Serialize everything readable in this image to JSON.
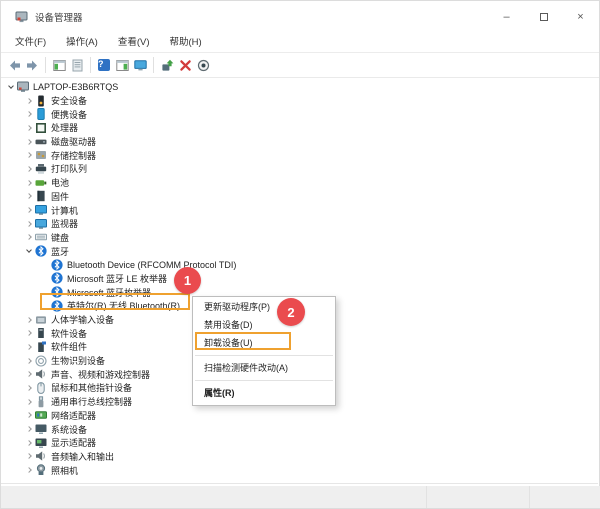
{
  "window": {
    "title": "设备管理器",
    "controls": [
      {
        "name": "minimize",
        "glyph": "–"
      },
      {
        "name": "maximize",
        "glyph": ""
      },
      {
        "name": "close",
        "glyph": "×"
      }
    ]
  },
  "menubar": {
    "items": [
      {
        "key": "file",
        "label": "文件(F)"
      },
      {
        "key": "action",
        "label": "操作(A)"
      },
      {
        "key": "view",
        "label": "查看(V)"
      },
      {
        "key": "help",
        "label": "帮助(H)"
      }
    ]
  },
  "toolbar": {
    "items": [
      {
        "icon": "back-icon"
      },
      {
        "icon": "forward-icon"
      },
      {
        "sep": true
      },
      {
        "icon": "console-tree-icon"
      },
      {
        "icon": "properties-icon"
      },
      {
        "sep": true
      },
      {
        "icon": "help-icon",
        "glyph": "?"
      },
      {
        "icon": "action-pane-icon"
      },
      {
        "icon": "computer-icon"
      },
      {
        "sep": true
      },
      {
        "icon": "update-driver-icon"
      },
      {
        "icon": "uninstall-device-icon"
      },
      {
        "icon": "scan-hardware-icon"
      }
    ]
  },
  "tree": {
    "items": [
      {
        "label": "LAPTOP-E3B6RTQS",
        "level": 0,
        "expander": "expanded",
        "icon": "computer-root-icon"
      },
      {
        "label": "安全设备",
        "level": 1,
        "expander": "collapsed",
        "icon": "security-icon"
      },
      {
        "label": "便携设备",
        "level": 1,
        "expander": "collapsed",
        "icon": "portable-icon"
      },
      {
        "label": "处理器",
        "level": 1,
        "expander": "collapsed",
        "icon": "processor-icon"
      },
      {
        "label": "磁盘驱动器",
        "level": 1,
        "expander": "collapsed",
        "icon": "disk-icon"
      },
      {
        "label": "存储控制器",
        "level": 1,
        "expander": "collapsed",
        "icon": "storage-icon"
      },
      {
        "label": "打印队列",
        "level": 1,
        "expander": "collapsed",
        "icon": "printer-icon"
      },
      {
        "label": "电池",
        "level": 1,
        "expander": "collapsed",
        "icon": "battery-icon"
      },
      {
        "label": "固件",
        "level": 1,
        "expander": "collapsed",
        "icon": "firmware-icon"
      },
      {
        "label": "计算机",
        "level": 1,
        "expander": "collapsed",
        "icon": "computer-icon"
      },
      {
        "label": "监视器",
        "level": 1,
        "expander": "collapsed",
        "icon": "monitor-icon"
      },
      {
        "label": "键盘",
        "level": 1,
        "expander": "collapsed",
        "icon": "keyboard-icon"
      },
      {
        "label": "蓝牙",
        "level": 1,
        "expander": "expanded",
        "icon": "bluetooth-icon"
      },
      {
        "label": "Bluetooth Device (RFCOMM Protocol TDI)",
        "level": 2,
        "expander": null,
        "icon": "bluetooth-icon"
      },
      {
        "label": "Microsoft 蓝牙 LE 枚举器",
        "level": 2,
        "expander": null,
        "icon": "bluetooth-icon"
      },
      {
        "label": "Microsoft 蓝牙枚举器",
        "level": 2,
        "expander": null,
        "icon": "bluetooth-icon"
      },
      {
        "label": "英特尔(R) 无线 Bluetooth(R)",
        "level": 2,
        "expander": null,
        "icon": "bluetooth-icon"
      },
      {
        "label": "人体学输入设备",
        "level": 1,
        "expander": "collapsed",
        "icon": "hid-icon"
      },
      {
        "label": "软件设备",
        "level": 1,
        "expander": "collapsed",
        "icon": "software-device-icon"
      },
      {
        "label": "软件组件",
        "level": 1,
        "expander": "collapsed",
        "icon": "software-component-icon"
      },
      {
        "label": "生物识别设备",
        "level": 1,
        "expander": "collapsed",
        "icon": "biometric-icon"
      },
      {
        "label": "声音、视频和游戏控制器",
        "level": 1,
        "expander": "collapsed",
        "icon": "audio-controller-icon"
      },
      {
        "label": "鼠标和其他指针设备",
        "level": 1,
        "expander": "collapsed",
        "icon": "mouse-icon"
      },
      {
        "label": "通用串行总线控制器",
        "level": 1,
        "expander": "collapsed",
        "icon": "usb-icon"
      },
      {
        "label": "网络适配器",
        "level": 1,
        "expander": "collapsed",
        "icon": "network-icon"
      },
      {
        "label": "系统设备",
        "level": 1,
        "expander": "collapsed",
        "icon": "system-device-icon"
      },
      {
        "label": "显示适配器",
        "level": 1,
        "expander": "collapsed",
        "icon": "display-adapter-icon"
      },
      {
        "label": "音频输入和输出",
        "level": 1,
        "expander": "collapsed",
        "icon": "audio-io-icon"
      },
      {
        "label": "照相机",
        "level": 1,
        "expander": "collapsed",
        "icon": "camera-icon"
      }
    ]
  },
  "context_menu": {
    "items": [
      {
        "type": "item",
        "label": "更新驱动程序(P)"
      },
      {
        "type": "item",
        "label": "禁用设备(D)"
      },
      {
        "type": "item",
        "label": "卸载设备(U)",
        "highlighted": true
      },
      {
        "type": "sep"
      },
      {
        "type": "item",
        "label": "扫描检测硬件改动(A)"
      },
      {
        "type": "sep"
      },
      {
        "type": "item",
        "label": "属性(R)",
        "bold": true
      }
    ]
  },
  "annotations": {
    "step1_label": "1",
    "step2_label": "2",
    "highlight_color": "#efa12f",
    "badge_color": "#ea4b4e"
  }
}
